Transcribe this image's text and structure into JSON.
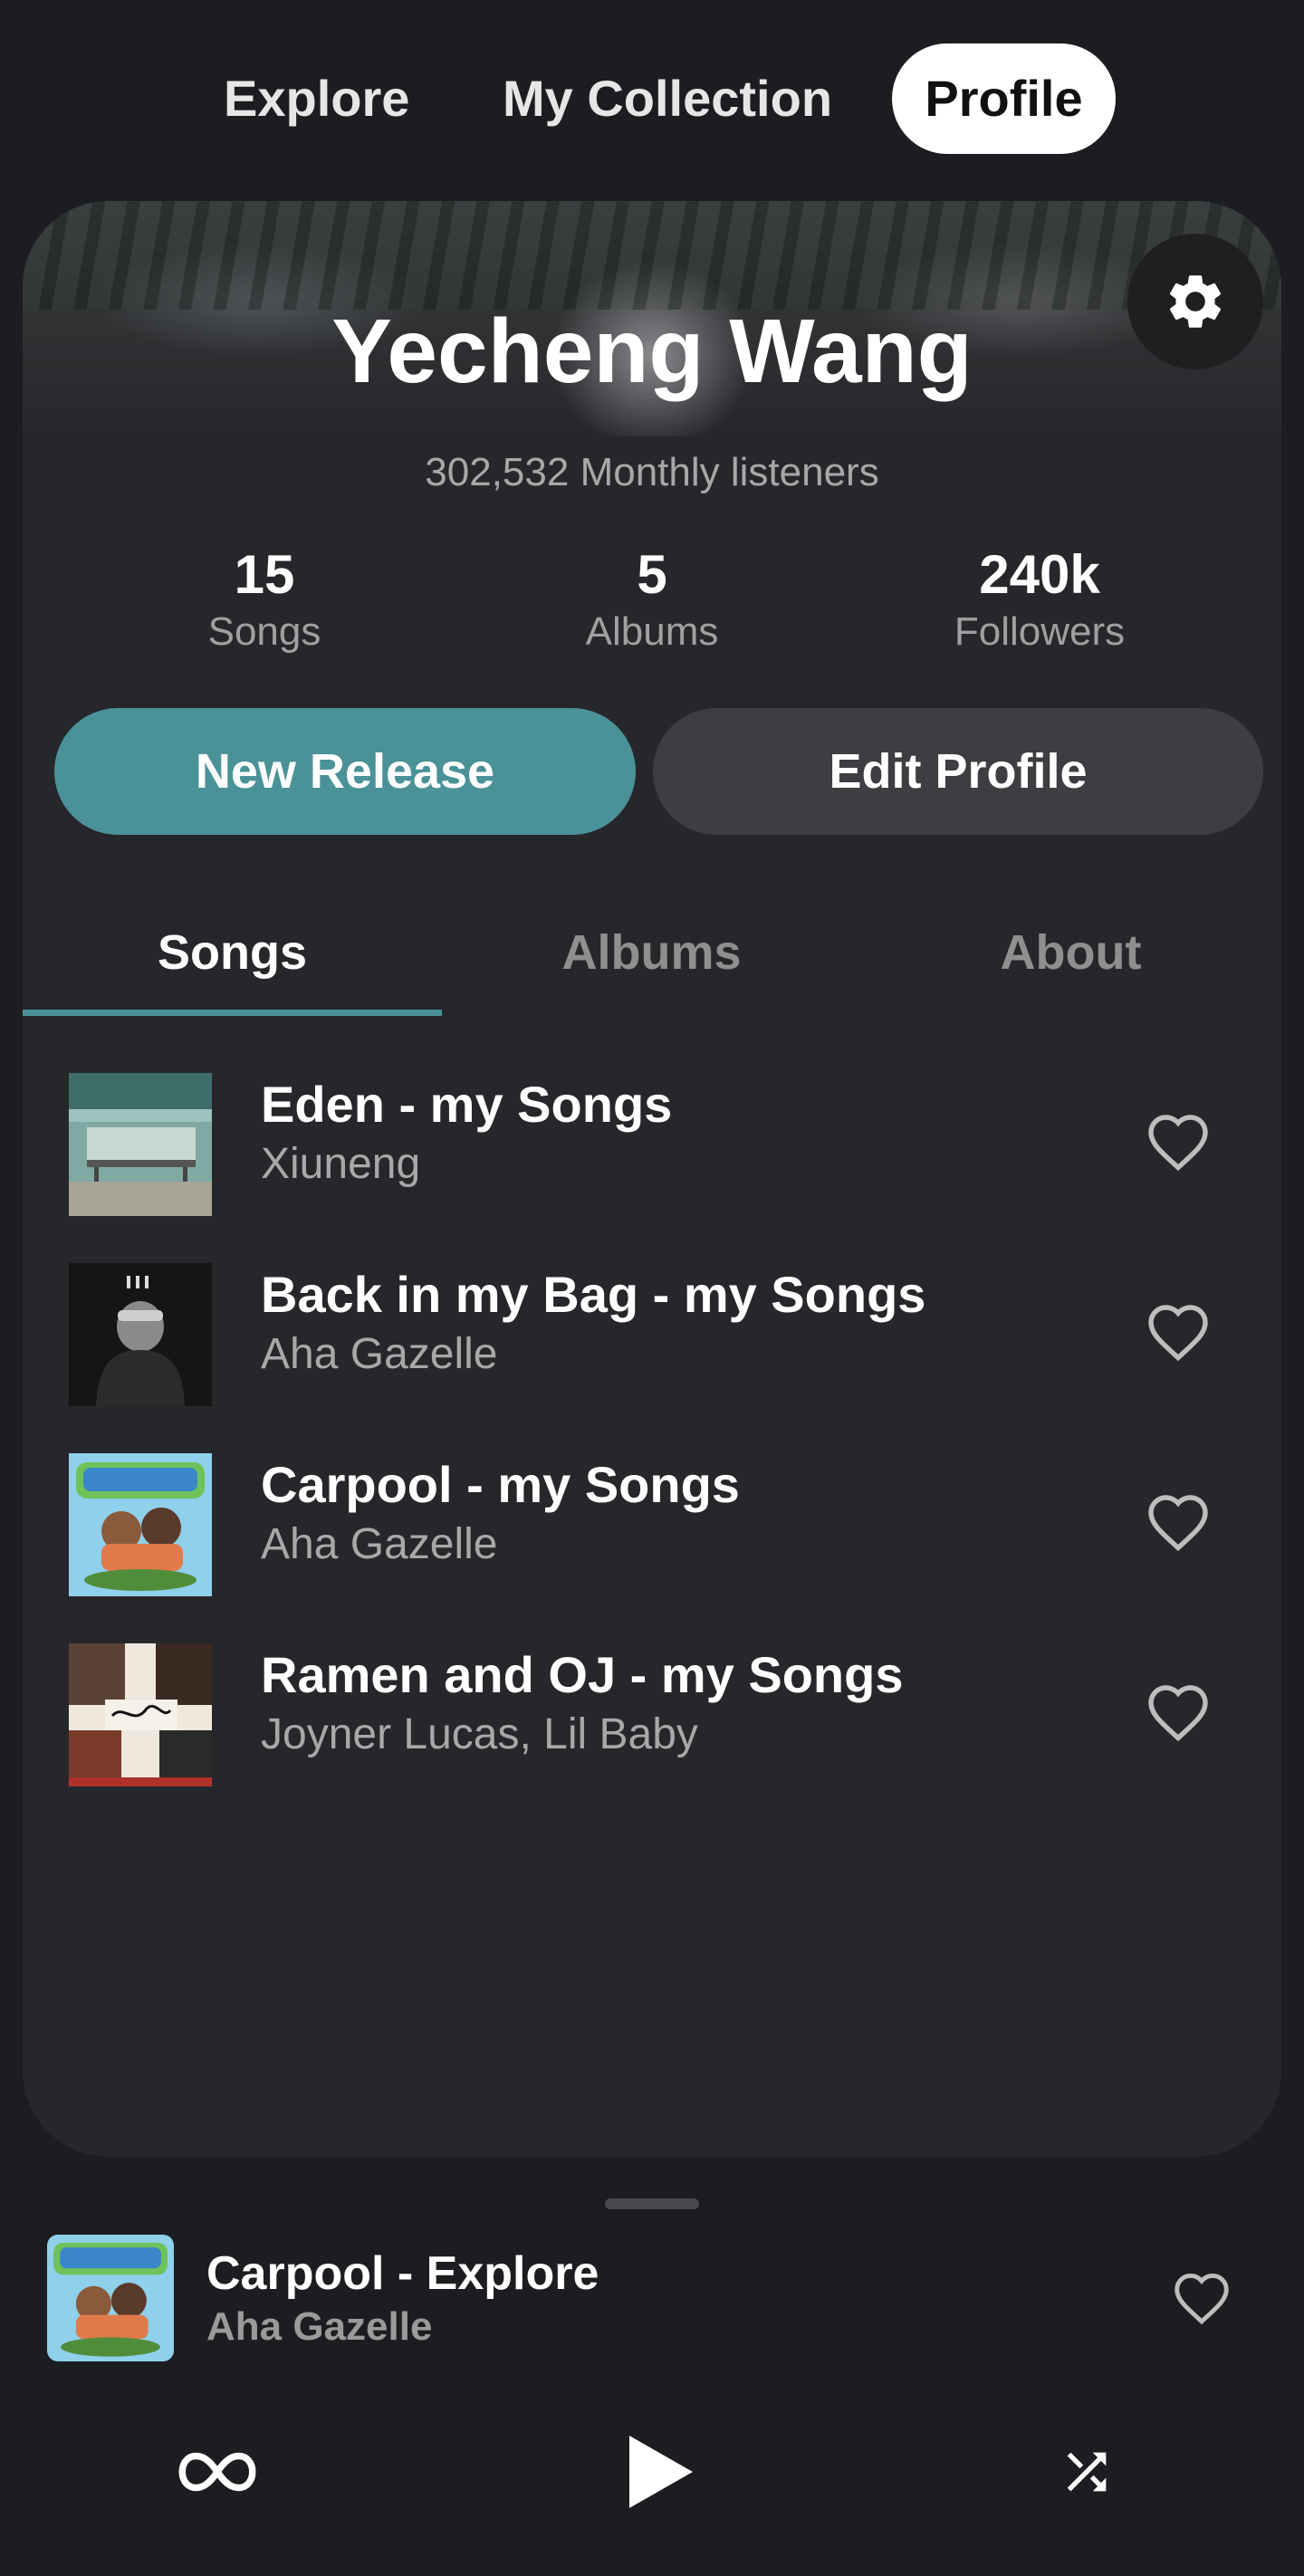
{
  "nav": {
    "explore": "Explore",
    "collection": "My Collection",
    "profile": "Profile"
  },
  "profile": {
    "name": "Yecheng Wang",
    "listeners": "302,532 Monthly listeners",
    "stats": [
      {
        "value": "15",
        "label": "Songs"
      },
      {
        "value": "5",
        "label": "Albums"
      },
      {
        "value": "240k",
        "label": "Followers"
      }
    ],
    "new_release_label": "New Release",
    "edit_profile_label": "Edit Profile"
  },
  "tabs": [
    "Songs",
    "Albums",
    "About"
  ],
  "active_tab": "Songs",
  "songs": [
    {
      "title": "Eden - my Songs",
      "artist": "Xiuneng",
      "icon": "heart-outline-icon"
    },
    {
      "title": "Back in my Bag - my Songs",
      "artist": "Aha Gazelle",
      "icon": "heart-outline-icon"
    },
    {
      "title": "Carpool - my Songs",
      "artist": "Aha Gazelle",
      "icon": "heart-outline-icon"
    },
    {
      "title": "Ramen and OJ - my Songs",
      "artist": "Joyner Lucas, Lil Baby",
      "icon": "heart-outline-icon"
    }
  ],
  "player": {
    "title": "Carpool - Explore",
    "artist": "Aha Gazelle",
    "controls": [
      "repeat-icon",
      "play-icon",
      "shuffle-icon"
    ]
  },
  "colors": {
    "background": "#1c1d21",
    "card": "#26272b",
    "accent": "#4b9298",
    "secondary_button": "#3e3e42"
  }
}
